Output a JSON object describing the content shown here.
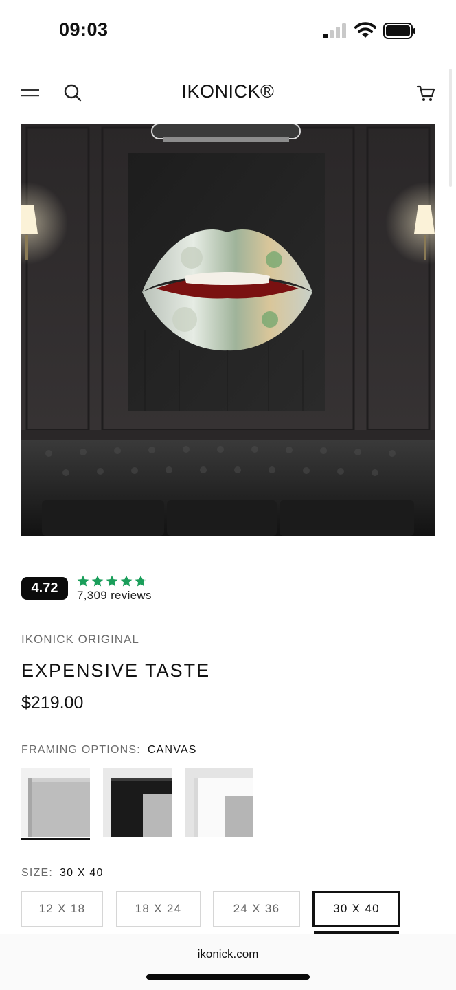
{
  "status_bar": {
    "time": "09:03",
    "icons": [
      "cellular-signal-icon",
      "wifi-icon",
      "battery-icon"
    ]
  },
  "header": {
    "logo": "IKONICK®",
    "icons": [
      "menu-icon",
      "search-icon",
      "cart-icon"
    ]
  },
  "product_image": {
    "subject": "lips-artwork-on-wall-above-chesterfield-sofa"
  },
  "rating": {
    "score": "4.72",
    "stars": 4.72,
    "reviews": "7,309 reviews",
    "star_color": "#1a9e5a"
  },
  "product": {
    "vendor": "IKONICK ORIGINAL",
    "title": "EXPENSIVE TASTE",
    "price": "$219.00"
  },
  "framing": {
    "label": "FRAMING OPTIONS:",
    "value": "CANVAS",
    "swatches": [
      {
        "name": "canvas",
        "selected": true
      },
      {
        "name": "black-frame",
        "selected": false
      },
      {
        "name": "white-frame",
        "selected": false
      }
    ]
  },
  "size": {
    "label": "SIZE:",
    "value": "30 X 40",
    "options": [
      {
        "label": "12 X 18",
        "selected": false
      },
      {
        "label": "18 X 24",
        "selected": false
      },
      {
        "label": "24 X 36",
        "selected": false
      },
      {
        "label": "30 X 40",
        "selected": true
      }
    ]
  },
  "browser": {
    "url": "ikonick.com"
  }
}
